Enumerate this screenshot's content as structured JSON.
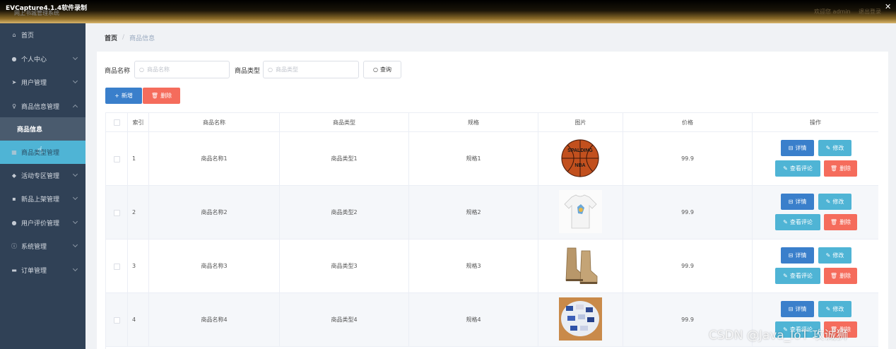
{
  "window": {
    "title": "EVCapture4.1.4软件录制",
    "subtitle": "网上书城管理系统",
    "right_text_1": "欢迎您 admin",
    "right_text_2": "退出登录",
    "close_glyph": "✕"
  },
  "sidebar": {
    "items": [
      {
        "label": "首页",
        "icon": "home-icon"
      },
      {
        "label": "个人中心",
        "icon": "user-icon"
      },
      {
        "label": "用户管理",
        "icon": "send-icon"
      },
      {
        "label": "商品信息管理",
        "icon": "mic-icon"
      },
      {
        "label": "商品信息",
        "icon": ""
      },
      {
        "label": "商品类型管理",
        "icon": "grid-icon"
      },
      {
        "label": "活动专区管理",
        "icon": "location-icon"
      },
      {
        "label": "新品上架管理",
        "icon": "apps-icon"
      },
      {
        "label": "用户评价管理",
        "icon": "user-icon"
      },
      {
        "label": "系统管理",
        "icon": "info-icon"
      },
      {
        "label": "订单管理",
        "icon": "list-icon"
      }
    ]
  },
  "breadcrumb": {
    "home": "首页",
    "separator": "/",
    "current": "商品信息"
  },
  "search": {
    "name_label": "商品名称",
    "name_placeholder": "商品名称",
    "type_label": "商品类型",
    "type_placeholder": "商品类型",
    "query_button": "查询"
  },
  "toolbar": {
    "add_label": "新增",
    "delete_label": "删除"
  },
  "table": {
    "headers": [
      "索引",
      "商品名称",
      "商品类型",
      "规格",
      "图片",
      "价格",
      "操作"
    ],
    "rows": [
      {
        "index": "1",
        "name": "商品名称1",
        "type": "商品类型1",
        "spec": "规格1",
        "image": "basketball",
        "price": "99.9"
      },
      {
        "index": "2",
        "name": "商品名称2",
        "type": "商品类型2",
        "spec": "规格2",
        "image": "tshirt",
        "price": "99.9"
      },
      {
        "index": "3",
        "name": "商品名称3",
        "type": "商品类型3",
        "spec": "规格3",
        "image": "boots",
        "price": "99.9"
      },
      {
        "index": "4",
        "name": "商品名称4",
        "type": "商品类型4",
        "spec": "规格4",
        "image": "candy",
        "price": "99.9"
      }
    ],
    "actions": {
      "detail": "详情",
      "edit": "修改",
      "review": "查看评论",
      "delete": "删除"
    }
  },
  "image_text": {
    "ball_brand": "SPALDING",
    "ball_logo": "NBA"
  },
  "watermark": "CSDN @Java_IoT 攻诚狮",
  "colors": {
    "sidebar": "#304156",
    "active": "#4fb4d5",
    "primary": "#3a7fcb",
    "danger": "#f56c5c"
  }
}
